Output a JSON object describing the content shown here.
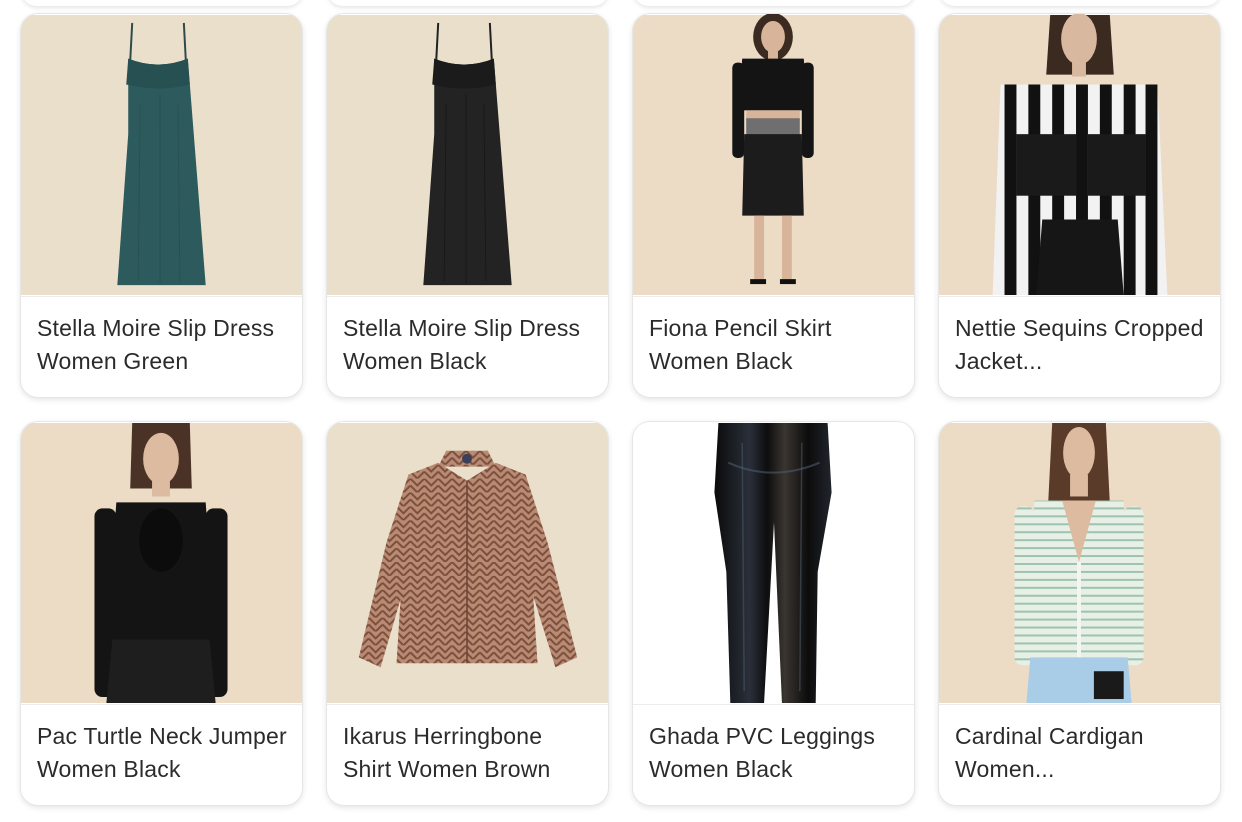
{
  "products": [
    {
      "title": "Stella Moire Slip Dress Women Green",
      "image": "green-slip-dress"
    },
    {
      "title": "Stella Moire Slip Dress Women Black",
      "image": "black-slip-dress"
    },
    {
      "title": "Fiona Pencil Skirt Women Black",
      "image": "model-pencil-skirt"
    },
    {
      "title": "Nettie Sequins Cropped Jacket...",
      "image": "model-striped-sequin-jacket"
    },
    {
      "title": "Pac Turtle Neck Jumper Women Black",
      "image": "model-black-jumper"
    },
    {
      "title": "Ikarus Herringbone Shirt Women Brown",
      "image": "herringbone-shirt"
    },
    {
      "title": "Ghada PVC Leggings Women Black",
      "image": "pvc-leggings"
    },
    {
      "title": "Cardinal Cardigan Women...",
      "image": "model-striped-cardigan"
    }
  ],
  "colors": {
    "beige_background": "#e9dfcb",
    "white_background": "#ffffff",
    "text": "#2b2b2b"
  }
}
